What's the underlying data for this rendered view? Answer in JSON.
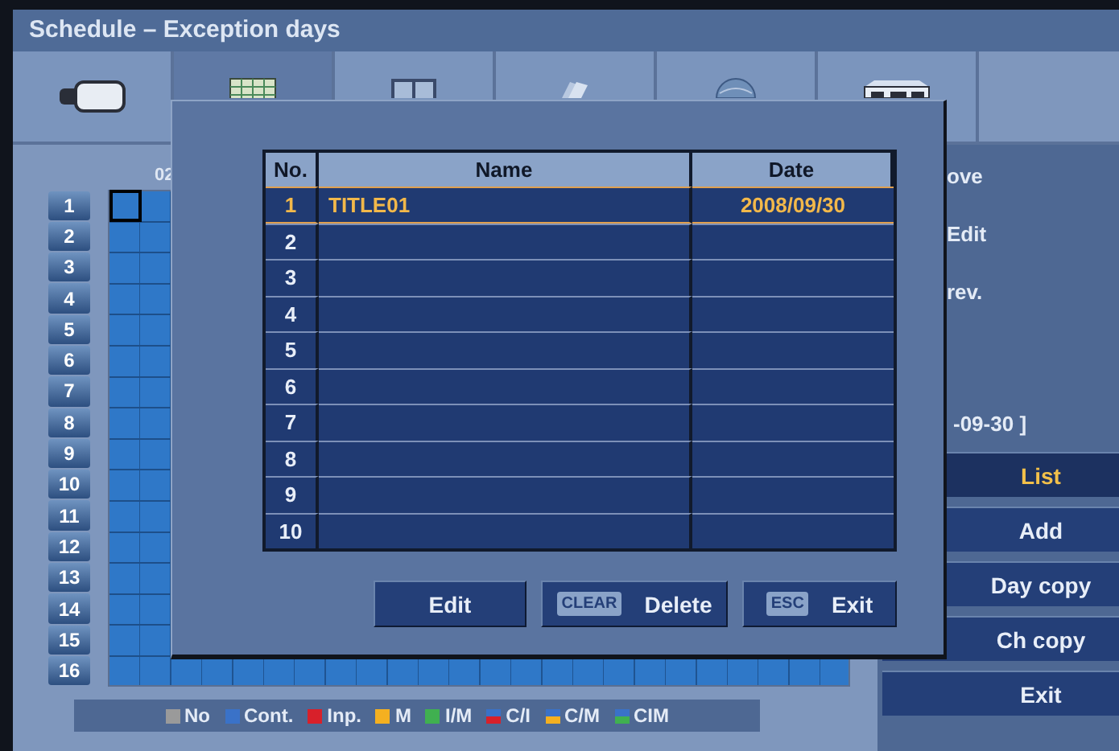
{
  "window": {
    "title": "Schedule – Exception days"
  },
  "tabs": [
    {
      "selected": false
    },
    {
      "selected": true
    },
    {
      "selected": false
    },
    {
      "selected": false
    },
    {
      "selected": false
    },
    {
      "selected": false
    }
  ],
  "grid": {
    "hour_label": "02",
    "cursor": true,
    "channels": [
      "1",
      "2",
      "3",
      "4",
      "5",
      "6",
      "7",
      "8",
      "9",
      "10",
      "11",
      "12",
      "13",
      "14",
      "15",
      "16"
    ]
  },
  "legend": [
    {
      "label": "No",
      "kind": "solid",
      "color": "#9a9a9a"
    },
    {
      "label": "Cont.",
      "kind": "solid",
      "color": "#3a72c8"
    },
    {
      "label": "Inp.",
      "kind": "solid",
      "color": "#d8202a"
    },
    {
      "label": "M",
      "kind": "solid",
      "color": "#f4b020"
    },
    {
      "label": "I/M",
      "kind": "solid",
      "color": "#40b050"
    },
    {
      "label": "C/I",
      "kind": "split",
      "color": "#d8202a"
    },
    {
      "label": "C/M",
      "kind": "split",
      "color": "#f4b020"
    },
    {
      "label": "CIM",
      "kind": "split",
      "color": "#40b050"
    }
  ],
  "side": {
    "hints": [
      "ove",
      "Edit",
      "rev."
    ],
    "date_range": "-09-30 ]",
    "buttons": [
      {
        "label": "List",
        "selected": true
      },
      {
        "label": "Add",
        "selected": false
      },
      {
        "label": "Day copy",
        "selected": false
      },
      {
        "label": "Ch copy",
        "selected": false
      },
      {
        "label": "Exit",
        "selected": false
      }
    ]
  },
  "dialog": {
    "columns": [
      "No.",
      "Name",
      "Date"
    ],
    "rows": [
      {
        "no": "1",
        "name": "TITLE01",
        "date": "2008/09/30",
        "selected": true
      },
      {
        "no": "2",
        "selected": false
      },
      {
        "no": "3",
        "selected": false
      },
      {
        "no": "4",
        "selected": false
      },
      {
        "no": "5",
        "selected": false
      },
      {
        "no": "6",
        "selected": false
      },
      {
        "no": "7",
        "selected": false
      },
      {
        "no": "8",
        "selected": false
      },
      {
        "no": "9",
        "selected": false
      },
      {
        "no": "10",
        "selected": false
      }
    ],
    "buttons": [
      {
        "label": "Edit"
      },
      {
        "label": "Delete",
        "key": "CLEAR"
      },
      {
        "label": "Exit",
        "key": "ESC"
      }
    ]
  }
}
